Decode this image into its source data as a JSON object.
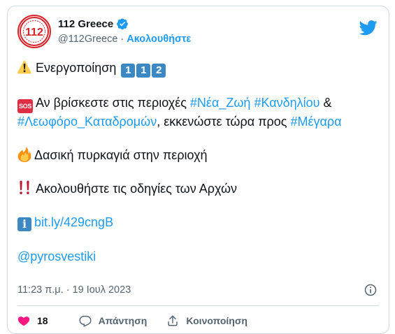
{
  "author": {
    "avatar_text": "112",
    "display_name": "112 Greece",
    "handle": "@112Greece",
    "separator": "·",
    "follow_label": "Ακολουθήστε"
  },
  "tweet": {
    "line1": {
      "emoji": "warning-icon",
      "text": "Ενεργοποίηση ",
      "keycaps": [
        "1",
        "1",
        "2"
      ]
    },
    "line2": {
      "badge": "SOS",
      "text_a": "Αν βρίσκεστε στις περιοχές ",
      "tag_1": "#Νέα_Ζωή",
      "tag_2": "#Κανδηλίου",
      "text_b": " & ",
      "tag_3": "#Λεωφόρο_Καταδρομών",
      "text_c": ", εκκενώστε τώρα προς ",
      "tag_4": "#Μέγαρα"
    },
    "line3": {
      "emoji": "fire-icon",
      "text": "Δασική πυρκαγιά στην περιοχή"
    },
    "line4": {
      "emoji": "double-exclamation-icon",
      "text": "Ακολουθήστε τις οδηγίες των Αρχών"
    },
    "line5": {
      "badge": "i",
      "link": "bit.ly/429cngB"
    },
    "line6": {
      "mention": "@pyrosvestiki"
    }
  },
  "meta": {
    "timestamp": "11:23 π.μ. · 19 Ιουλ 2023"
  },
  "actions": {
    "like_count": "18",
    "reply_label": "Απάντηση",
    "share_label": "Κοινοποίηση"
  },
  "colors": {
    "accent": "#1d9bf0",
    "like": "#f91880",
    "text": "#0f1419",
    "muted": "#536471",
    "border": "#cfd9de",
    "brand_red": "#d8232a"
  }
}
